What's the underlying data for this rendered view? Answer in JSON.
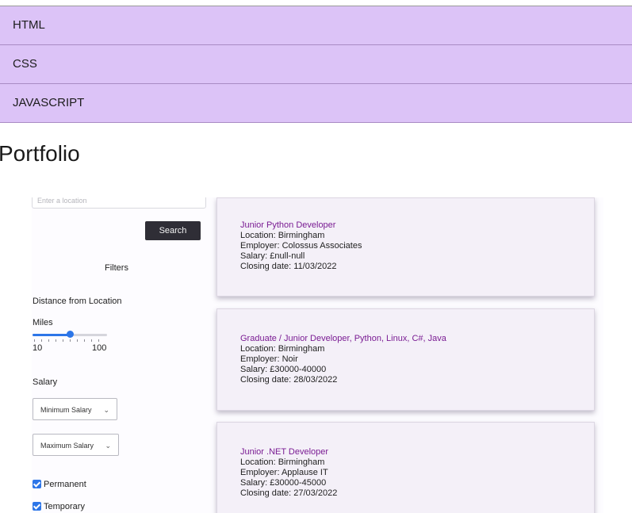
{
  "nav": {
    "items": [
      "HTML",
      "CSS",
      "JAVASCRIPT"
    ]
  },
  "page_title": "Portfolio",
  "screenshot": {
    "location_placeholder": "Enter a location",
    "search_label": "Search",
    "filters_label": "Filters",
    "distance_label": "Distance from Location",
    "miles_label": "Miles",
    "slider": {
      "min": "10",
      "max": "100",
      "value_fraction": 0.5
    },
    "salary_label": "Salary",
    "min_salary": "Minimum Salary",
    "max_salary": "Maximum Salary",
    "permanent_label": "Permanent",
    "temporary_label": "Temporary",
    "jobs": [
      {
        "title": "Junior Python Developer",
        "location": "Location: Birmingham",
        "employer": "Employer: Colossus Associates",
        "salary": "Salary: £null-null",
        "closing": "Closing date: 11/03/2022"
      },
      {
        "title": "Graduate / Junior Developer, Python, Linux, C#, Java",
        "location": "Location: Birmingham",
        "employer": "Employer: Noir",
        "salary": "Salary: £30000-40000",
        "closing": "Closing date: 28/03/2022"
      },
      {
        "title": "Junior .NET Developer",
        "location": "Location: Birmingham",
        "employer": "Employer: Applause IT",
        "salary": "Salary: £30000-45000",
        "closing": "Closing date: 27/03/2022"
      }
    ]
  },
  "colors": {
    "nav_bg": "#dcc3f7",
    "job_title": "#7a1c93",
    "accent": "#2d76e8",
    "button": "#2f2e36"
  }
}
